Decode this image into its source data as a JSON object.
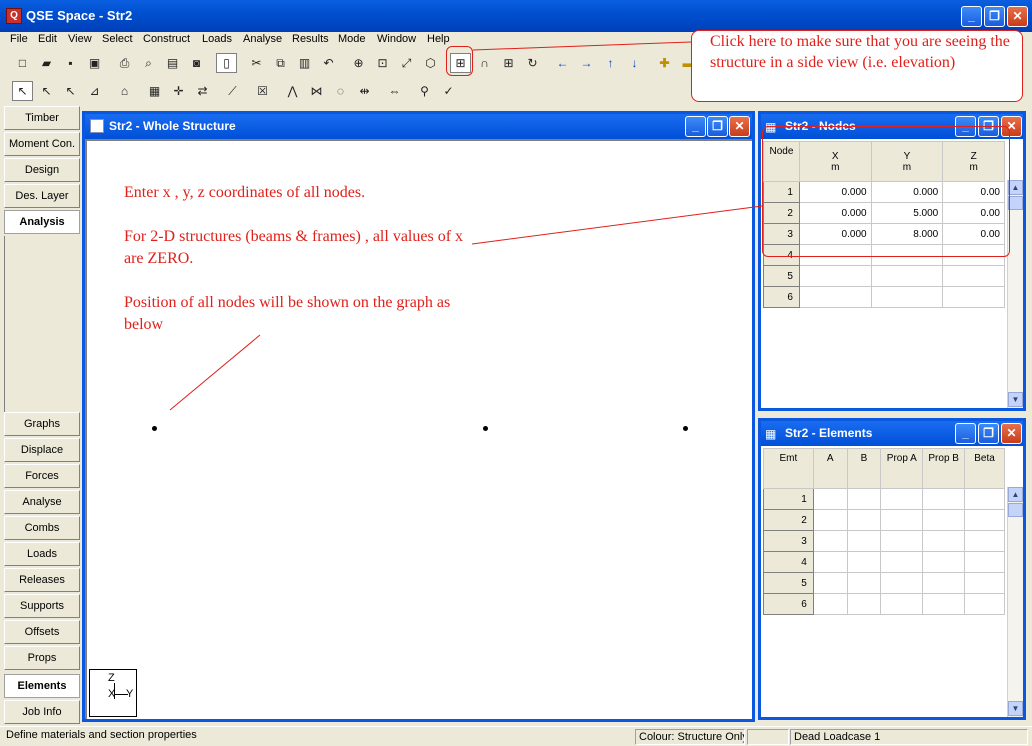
{
  "window": {
    "title": "QSE Space - Str2"
  },
  "menu": [
    "File",
    "Edit",
    "View",
    "Select",
    "Construct",
    "Loads",
    "Analyse",
    "Results",
    "Mode",
    "Window",
    "Help"
  ],
  "sidebar": {
    "top_items": [
      "Timber",
      "Moment Con.",
      "Design",
      "Des. Layer",
      "Analysis"
    ],
    "bottom_items": [
      "Graphs",
      "Displace",
      "Forces",
      "Analyse",
      "Combs",
      "Loads",
      "Releases",
      "Supports",
      "Offsets",
      "Props",
      "Elements",
      "Job Info"
    ],
    "active": [
      "Analysis",
      "Elements"
    ]
  },
  "structure_window": {
    "title": "Str2 - Whole Structure",
    "axis_labels": {
      "z": "Z",
      "x": "X",
      "y": "Y"
    }
  },
  "annotations": {
    "elevation_note": "Click here to make sure that you are seeing the structure in a side view (i.e. elevation)",
    "enter_coords": "Enter x , y, z coordinates of all nodes.",
    "two_d_note": "For 2-D structures (beams & frames) , all values of x are ZERO.",
    "position_note": "Position of all nodes will be shown on the graph as below"
  },
  "nodes_window": {
    "title": "Str2 - Nodes",
    "columns": [
      {
        "name": "Node",
        "unit": ""
      },
      {
        "name": "X",
        "unit": "m"
      },
      {
        "name": "Y",
        "unit": "m"
      },
      {
        "name": "Z",
        "unit": "m"
      }
    ],
    "rows": [
      {
        "id": "1",
        "x": "0.000",
        "y": "0.000",
        "z": "0.00"
      },
      {
        "id": "2",
        "x": "0.000",
        "y": "5.000",
        "z": "0.00"
      },
      {
        "id": "3",
        "x": "0.000",
        "y": "8.000",
        "z": "0.00"
      },
      {
        "id": "4",
        "x": "",
        "y": "",
        "z": ""
      },
      {
        "id": "5",
        "x": "",
        "y": "",
        "z": ""
      },
      {
        "id": "6",
        "x": "",
        "y": "",
        "z": ""
      }
    ]
  },
  "elements_window": {
    "title": "Str2 - Elements",
    "columns": [
      "Emt",
      "A",
      "B",
      "Prop A",
      "Prop B",
      "Beta"
    ],
    "rows": [
      "1",
      "2",
      "3",
      "4",
      "5",
      "6"
    ]
  },
  "status": {
    "message": "Define materials and section properties",
    "colour": "Colour: Structure Only",
    "blank": "",
    "loadcase": "Dead Loadcase 1"
  },
  "colors": {
    "titlebar": "#0050d0",
    "annotation": "#e0201a"
  }
}
